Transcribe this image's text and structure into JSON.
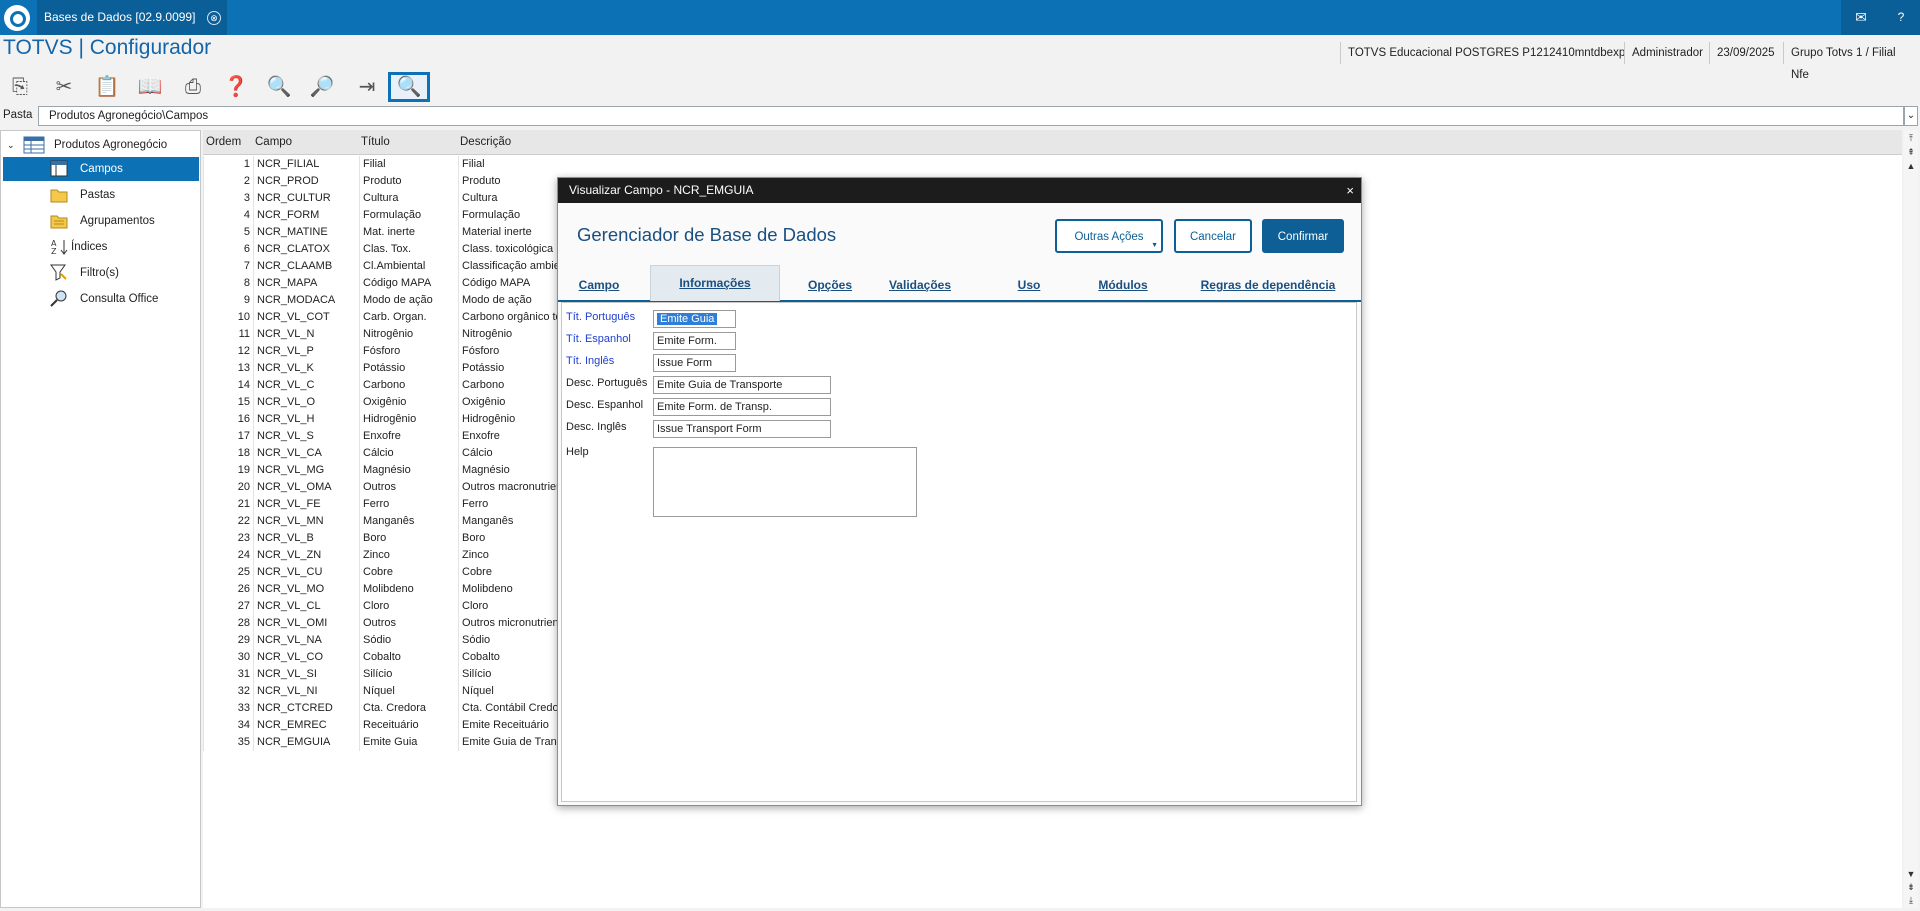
{
  "window": {
    "tab_title": "Bases de Dados [02.9.0099]",
    "tab_close": "⊗"
  },
  "header": {
    "app_title": "TOTVS | Configurador",
    "environment": "TOTVS Educacional POSTGRES P1212410mntdbexp",
    "user": "Administrador",
    "date": "23/09/2025",
    "branch": "Grupo Totvs 1 / Filial Nfe"
  },
  "toolbar": {
    "icons": [
      "copy-icon",
      "cut-icon",
      "paste-icon",
      "book-icon",
      "print-icon",
      "help-icon",
      "search-icon",
      "search-next-icon",
      "exit-icon",
      "preview-icon"
    ]
  },
  "pasta": {
    "label": "Pasta",
    "value": "Produtos Agronegócio\\Campos"
  },
  "tree": {
    "root": "Produtos Agronegócio",
    "items": [
      {
        "label": "Campos",
        "selected": true
      },
      {
        "label": "Pastas"
      },
      {
        "label": "Agrupamentos"
      },
      {
        "label": "Índices"
      },
      {
        "label": "Filtro(s)"
      },
      {
        "label": "Consulta Office"
      }
    ]
  },
  "grid": {
    "columns": [
      "Ordem",
      "Campo",
      "Título",
      "Descrição"
    ],
    "rows": [
      [
        "1",
        "NCR_FILIAL",
        "Filial",
        "Filial"
      ],
      [
        "2",
        "NCR_PROD",
        "Produto",
        "Produto"
      ],
      [
        "3",
        "NCR_CULTUR",
        "Cultura",
        "Cultura"
      ],
      [
        "4",
        "NCR_FORM",
        "Formulação",
        "Formulação"
      ],
      [
        "5",
        "NCR_MATINE",
        "Mat. inerte",
        "Material inerte"
      ],
      [
        "6",
        "NCR_CLATOX",
        "Clas. Tox.",
        "Class. toxicológica"
      ],
      [
        "7",
        "NCR_CLAAMB",
        "Cl.Ambiental",
        "Classificação ambie"
      ],
      [
        "8",
        "NCR_MAPA",
        "Código MAPA",
        "Código MAPA"
      ],
      [
        "9",
        "NCR_MODACA",
        "Modo de ação",
        "Modo de ação"
      ],
      [
        "10",
        "NCR_VL_COT",
        "Carb. Organ.",
        "Carbono orgânico to"
      ],
      [
        "11",
        "NCR_VL_N",
        "Nitrogênio",
        "Nitrogênio"
      ],
      [
        "12",
        "NCR_VL_P",
        "Fósforo",
        "Fósforo"
      ],
      [
        "13",
        "NCR_VL_K",
        "Potássio",
        "Potássio"
      ],
      [
        "14",
        "NCR_VL_C",
        "Carbono",
        "Carbono"
      ],
      [
        "15",
        "NCR_VL_O",
        "Oxigênio",
        "Oxigênio"
      ],
      [
        "16",
        "NCR_VL_H",
        "Hidrogênio",
        "Hidrogênio"
      ],
      [
        "17",
        "NCR_VL_S",
        "Enxofre",
        "Enxofre"
      ],
      [
        "18",
        "NCR_VL_CA",
        "Cálcio",
        "Cálcio"
      ],
      [
        "19",
        "NCR_VL_MG",
        "Magnésio",
        "Magnésio"
      ],
      [
        "20",
        "NCR_VL_OMA",
        "Outros",
        "Outros macronutrien"
      ],
      [
        "21",
        "NCR_VL_FE",
        "Ferro",
        "Ferro"
      ],
      [
        "22",
        "NCR_VL_MN",
        "Manganês",
        "Manganês"
      ],
      [
        "23",
        "NCR_VL_B",
        "Boro",
        "Boro"
      ],
      [
        "24",
        "NCR_VL_ZN",
        "Zinco",
        "Zinco"
      ],
      [
        "25",
        "NCR_VL_CU",
        "Cobre",
        "Cobre"
      ],
      [
        "26",
        "NCR_VL_MO",
        "Molibdeno",
        "Molibdeno"
      ],
      [
        "27",
        "NCR_VL_CL",
        "Cloro",
        "Cloro"
      ],
      [
        "28",
        "NCR_VL_OMI",
        "Outros",
        "Outros micronutrien"
      ],
      [
        "29",
        "NCR_VL_NA",
        "Sódio",
        "Sódio"
      ],
      [
        "30",
        "NCR_VL_CO",
        "Cobalto",
        "Cobalto"
      ],
      [
        "31",
        "NCR_VL_SI",
        "Silício",
        "Silício"
      ],
      [
        "32",
        "NCR_VL_NI",
        "Níquel",
        "Níquel"
      ],
      [
        "33",
        "NCR_CTCRED",
        "Cta. Credora",
        "Cta. Contábil Credo"
      ],
      [
        "34",
        "NCR_EMREC",
        "Receituário",
        "Emite Receituário"
      ],
      [
        "35",
        "NCR_EMGUIA",
        "Emite Guia",
        "Emite Guia de Trans"
      ]
    ]
  },
  "dialog": {
    "title": "Visualizar Campo - NCR_EMGUIA",
    "close": "×",
    "heading": "Gerenciador de Base de Dados",
    "buttons": {
      "more": "Outras Ações",
      "cancel": "Cancelar",
      "confirm": "Confirmar"
    },
    "tabs": [
      "Campo",
      "Informações",
      "Opções",
      "Validações",
      "Uso",
      "Módulos",
      "Regras de dependência"
    ],
    "active_tab": "Informações",
    "fields": {
      "tit_pt_label": "Tít. Português",
      "tit_pt_value": "Emite Guia",
      "tit_es_label": "Tít. Espanhol",
      "tit_es_value": "Emite Form.",
      "tit_en_label": "Tít. Inglês",
      "tit_en_value": "Issue Form",
      "desc_pt_label": "Desc. Português",
      "desc_pt_value": "Emite Guia de Transporte",
      "desc_es_label": "Desc. Espanhol",
      "desc_es_value": "Emite Form. de Transp.",
      "desc_en_label": "Desc. Inglês",
      "desc_en_value": "Issue Transport Form",
      "help_label": "Help",
      "help_value": ""
    }
  }
}
